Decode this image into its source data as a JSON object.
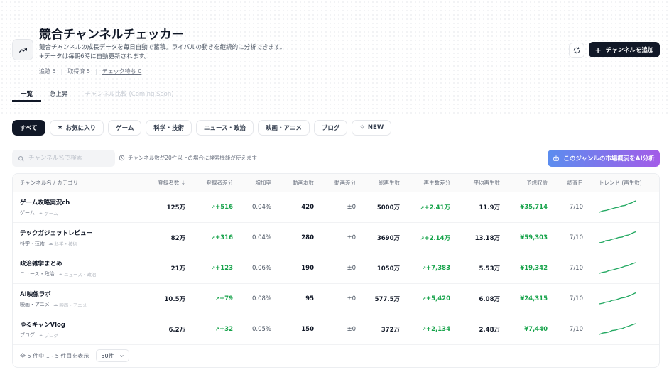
{
  "header": {
    "title": "競合チャンネルチェッカー",
    "desc_line1": "競合チャンネルの成長データを毎日自動で蓄積。ライバルの動きを継続的に分析できます。",
    "desc_line2": "※データは毎朝6時に自動更新されます。",
    "tracked": "追跡 5",
    "fetched": "取得済 5",
    "pending": "チェック待ち 0",
    "add_button": "チャンネルを追加"
  },
  "tabs": [
    {
      "label": "一覧",
      "active": true
    },
    {
      "label": "急上昇",
      "active": false
    },
    {
      "label": "チャンネル比較 (Coming Soon)",
      "disabled": true
    }
  ],
  "filters": [
    {
      "label": "すべて",
      "active": true
    },
    {
      "label": "お気に入り",
      "icon": "star-icon"
    },
    {
      "label": "ゲーム"
    },
    {
      "label": "科学・技術"
    },
    {
      "label": "ニュース・政治"
    },
    {
      "label": "映画・アニメ"
    },
    {
      "label": "ブログ"
    },
    {
      "label": "NEW",
      "icon": "sparkle-icon"
    }
  ],
  "search": {
    "placeholder": "チャンネル名で検索",
    "note": "チャンネル数が20件以上の場合に検索機能が使えます"
  },
  "ai_button": "このジャンルの市場概況をAI分析",
  "table": {
    "headers": [
      "チャンネル名 / カテゴリ",
      "登録者数 ↓",
      "登録者差分",
      "増加率",
      "動画本数",
      "動画差分",
      "総再生数",
      "再生数差分",
      "平均再生数",
      "予想収益",
      "調査日",
      "トレンド (再生数)"
    ],
    "rows": [
      {
        "name": "ゲーム攻略実況ch",
        "cat": "ゲーム",
        "cat2": "ゲーム",
        "subs": "125万",
        "sub_diff": "+516",
        "rate": "0.04%",
        "videos": "420",
        "video_diff": "±0",
        "views": "5000万",
        "views_diff": "+2.41万",
        "avg": "11.9万",
        "revenue": "¥35,714",
        "date": "7/10"
      },
      {
        "name": "テックガジェットレビュー",
        "cat": "科学・技術",
        "cat2": "科学・技術",
        "subs": "82万",
        "sub_diff": "+316",
        "rate": "0.04%",
        "videos": "280",
        "video_diff": "±0",
        "views": "3690万",
        "views_diff": "+2.14万",
        "avg": "13.18万",
        "revenue": "¥59,303",
        "date": "7/10"
      },
      {
        "name": "政治雑学まとめ",
        "cat": "ニュース・政治",
        "cat2": "ニュース・政治",
        "subs": "21万",
        "sub_diff": "+123",
        "rate": "0.06%",
        "videos": "190",
        "video_diff": "±0",
        "views": "1050万",
        "views_diff": "+7,383",
        "avg": "5.53万",
        "revenue": "¥19,342",
        "date": "7/10"
      },
      {
        "name": "AI映像ラボ",
        "cat": "映画・アニメ",
        "cat2": "映画・アニメ",
        "subs": "10.5万",
        "sub_diff": "+79",
        "rate": "0.08%",
        "videos": "95",
        "video_diff": "±0",
        "views": "577.5万",
        "views_diff": "+5,420",
        "avg": "6.08万",
        "revenue": "¥24,315",
        "date": "7/10"
      },
      {
        "name": "ゆるキャンVlog",
        "cat": "ブログ",
        "cat2": "ブログ",
        "subs": "6.2万",
        "sub_diff": "+32",
        "rate": "0.05%",
        "videos": "150",
        "video_diff": "±0",
        "views": "372万",
        "views_diff": "+2,134",
        "avg": "2.48万",
        "revenue": "¥7,440",
        "date": "7/10"
      }
    ]
  },
  "footer": {
    "summary": "全 5 件中 1 - 5 件目を表示",
    "per_page": "50件"
  },
  "colors": {
    "accent_dark": "#111827",
    "positive": "#16a34a",
    "ai_gradient_start": "#5b8def",
    "ai_gradient_end": "#a35ce8"
  }
}
